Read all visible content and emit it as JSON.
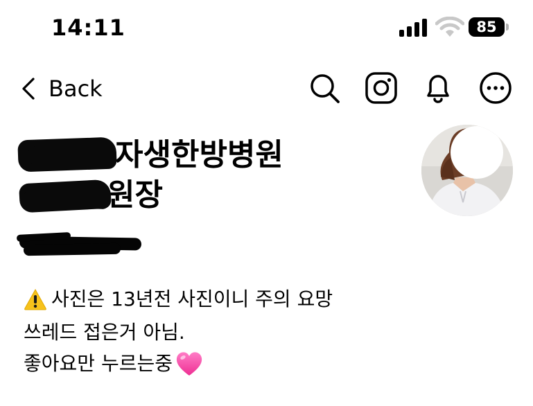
{
  "status_bar": {
    "time": "14:11",
    "battery_percent": "85",
    "icons": [
      "signal-icon",
      "wifi-icon",
      "battery-icon"
    ]
  },
  "nav": {
    "back_label": "Back",
    "icons": [
      "search-icon",
      "instagram-icon",
      "bell-icon",
      "more-icon"
    ]
  },
  "profile": {
    "name_line_1": "자생한방병원",
    "name_line_2": "원장"
  },
  "bio": {
    "line_1": "사진은 13년전 사진이니 주의 요망",
    "line_2": "쓰레드 접은거 아님.",
    "line_3": "좋아요만 누르는중",
    "line_1_icon": "warning-icon",
    "line_3_icon": "pink-heart-icon"
  },
  "colors": {
    "background": "#ffffff",
    "text": "#000000",
    "warning": "#f7c21b",
    "heart": "#ff4fae"
  }
}
